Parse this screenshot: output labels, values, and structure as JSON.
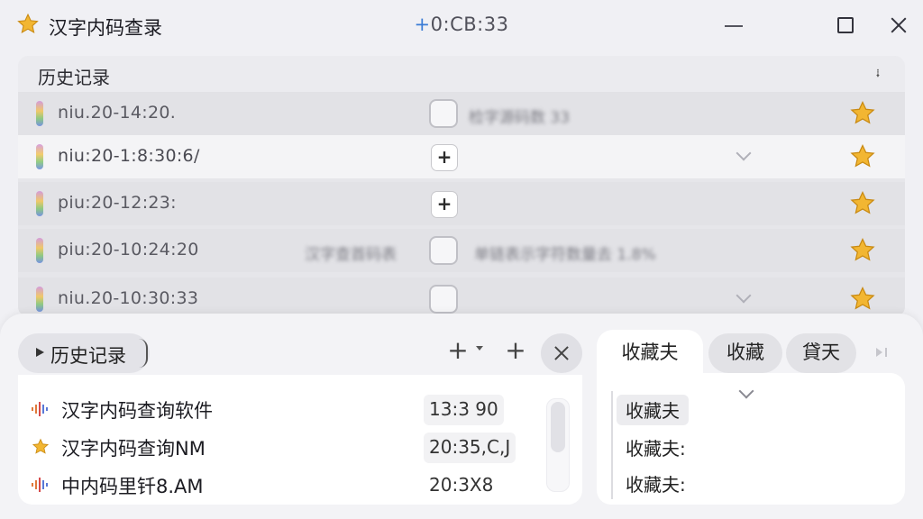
{
  "titlebar": {
    "title": "汉字内码查录",
    "clock_prefix": "+",
    "clock": "0:CB:33",
    "icon": "star-icon"
  },
  "history": {
    "title": "历史记录",
    "rows": [
      {
        "time": "niu.20-14:20.",
        "control": "checkbox",
        "blur_text": "检字源码数 33",
        "style": "dim"
      },
      {
        "time": "niu:20-1:8:30:6/",
        "control": "add",
        "blur_text": "",
        "style": "light"
      },
      {
        "time": "piu:20-12:23:",
        "control": "add",
        "blur_text": "",
        "style": "dim"
      },
      {
        "time": "piu:20-10:24:20",
        "control": "checkbox",
        "blur_text": "汉字查首码表",
        "blur_text_2": "单链表示字符数量去 1.8%",
        "style": "dim"
      },
      {
        "time": "niu.20-10:30:33",
        "control": "checkbox",
        "blur_text": "",
        "style": "dim"
      }
    ]
  },
  "bottom": {
    "left_tab": "历史记录",
    "list": [
      {
        "icon": "waveform-icon",
        "text": "汉字内码查询软件",
        "time": "13:3 90"
      },
      {
        "icon": "star-icon",
        "text": "汉字内码查询NM",
        "time": "20:35,C,J"
      },
      {
        "icon": "waveform-icon",
        "text": "中内码里钎8.AM",
        "time": "20:3X8"
      }
    ],
    "right_tabs": [
      "收藏夫",
      "收藏",
      "貸天"
    ],
    "favorites": [
      "收藏夫",
      "收藏夫:",
      "收藏夫:"
    ]
  },
  "colors": {
    "accent": "#3a7bd5",
    "star": "#f2b632"
  }
}
